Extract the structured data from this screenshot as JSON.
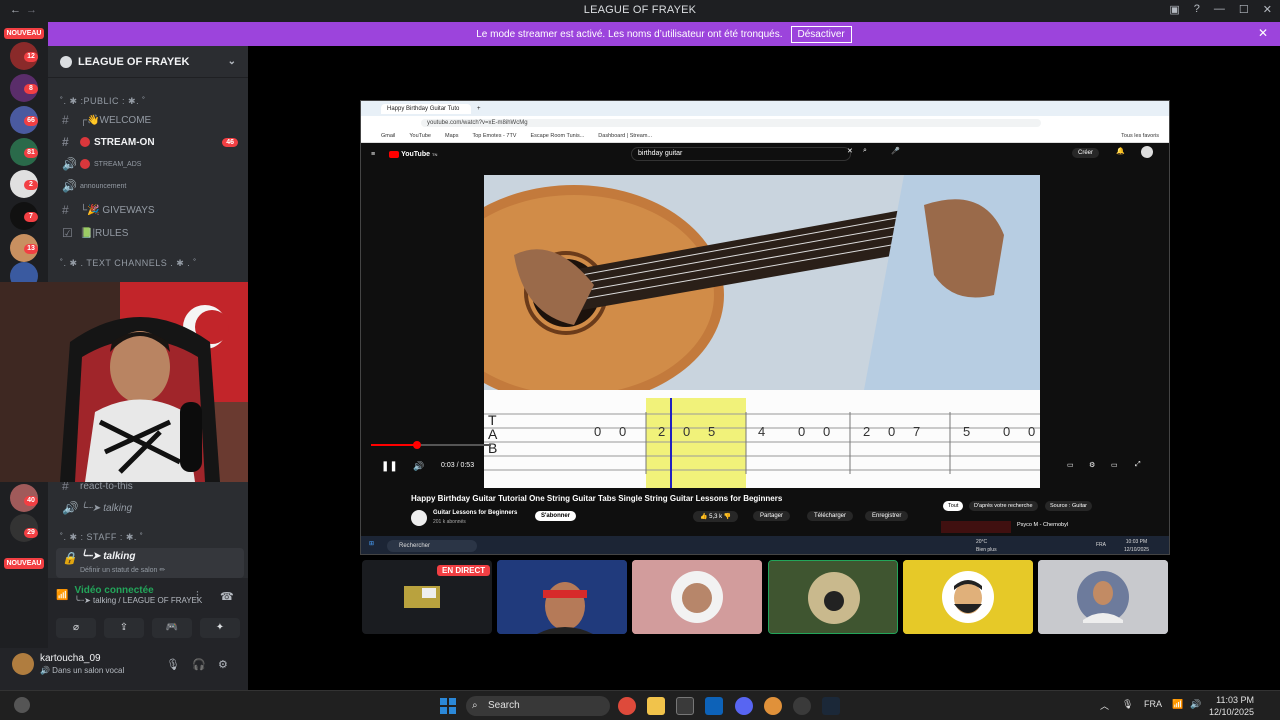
{
  "app": {
    "title": "LEAGUE OF FRAYEK",
    "back_icon": "arrow-left-icon",
    "forward_icon": "arrow-right-icon"
  },
  "banner": {
    "text": "Le mode streamer est activé. Les noms d’utilisateur ont été tronqués.",
    "button": "Désactiver",
    "close": "✕",
    "color": "#9c44dc"
  },
  "rail": {
    "nouveau": "NOUVEAU",
    "badges": [
      "12",
      "8",
      "66",
      "81",
      "2",
      "7",
      "13",
      "40",
      "29"
    ]
  },
  "server": {
    "name": "LEAGUE OF FRAYEK",
    "categories": {
      "public": "˚. ✱ :PUBLIC : ✱. ˚",
      "text": "˚. ✱ . TEXT CHANNELS . ✱ . ˚",
      "staff": "˚. ✱ : STAFF : ✱. ˚"
    },
    "channels": [
      {
        "label": "┌👋WELCOME",
        "sym": "#"
      },
      {
        "label": "STREAM-ON",
        "sym": "#",
        "count": "46"
      },
      {
        "label": "STREAM_ADS",
        "sym": "🔊"
      },
      {
        "label": "announcement",
        "sym": "🔊"
      },
      {
        "label": "└🎉 GIVEWAYS",
        "sym": "#"
      },
      {
        "label": "📗|RULES",
        "sym": "☑"
      }
    ],
    "voice_channels": [
      {
        "label": "react-to-this",
        "sym": "#"
      },
      {
        "label": "╰┈➤ talking",
        "sym": "🔊"
      },
      {
        "label": "╰┈➤ talking",
        "sym": "🔒",
        "sub": "Définir un statut de salon ✏"
      }
    ]
  },
  "voice": {
    "status": "Vidéo connectée",
    "location": "╰┈➤ talking / LEAGUE OF FRAYEK",
    "buttons": [
      "camera-off-icon",
      "screen-share-icon",
      "activity-icon",
      "soundboard-icon"
    ]
  },
  "user": {
    "name": "kartoucha_09",
    "status": "🔊 Dans un salon vocal"
  },
  "browser": {
    "tab_title": "Happy Birthday Guitar Tuto",
    "url": "youtube.com/watch?v=xE-m8ihWcMg",
    "bookmarks": [
      "Gmail",
      "YouTube",
      "Maps",
      "Top Emotes - 7TV",
      "Escape Room Tunis...",
      "Dashboard | Stream..."
    ],
    "all_bookmarks": "Tous les favoris",
    "search_query": "birthday guitar",
    "create_label": "Créer",
    "yt_logo": "YouTube",
    "yt_country": "TN"
  },
  "video": {
    "title": "Happy Birthday Guitar Tutorial One String Guitar Tabs Single String Guitar Lessons for Beginners",
    "time": "0:03 / 0:53",
    "progress": 0.06,
    "channel": "Guitar Lessons for Beginners",
    "subscribers": "201 k abonnés",
    "subscribe": "S'abonner",
    "likes": "5,3 k",
    "share": "Partager",
    "download": "Télécharger",
    "save": "Enregistrer",
    "chips": [
      "Tout",
      "D'après votre recherche",
      "Source : Guitar"
    ],
    "tab_letters": [
      "T",
      "A",
      "B"
    ],
    "tab_notes": [
      "0",
      "0",
      "2",
      "0",
      "5",
      "4",
      "0",
      "0",
      "2",
      "0",
      "7",
      "5",
      "0",
      "0"
    ],
    "up_next": "Psyco M - Chernobyl"
  },
  "inner_taskbar": {
    "search": "Rechercher",
    "weather": "20°C",
    "weather_sub": "Bien plus",
    "lang": "FRA",
    "time": "10:03 PM",
    "date": "12/10/2025"
  },
  "stage": {
    "live_badge": "EN DIRECT",
    "tiles": [
      "screen",
      "user-headband",
      "user-keffiyeh",
      "user-cartoon",
      "user-beard-avatar",
      "user-football"
    ]
  },
  "taskbar": {
    "search": "Search",
    "lang": "FRA",
    "time": "11:03 PM",
    "date": "12/10/2025"
  }
}
